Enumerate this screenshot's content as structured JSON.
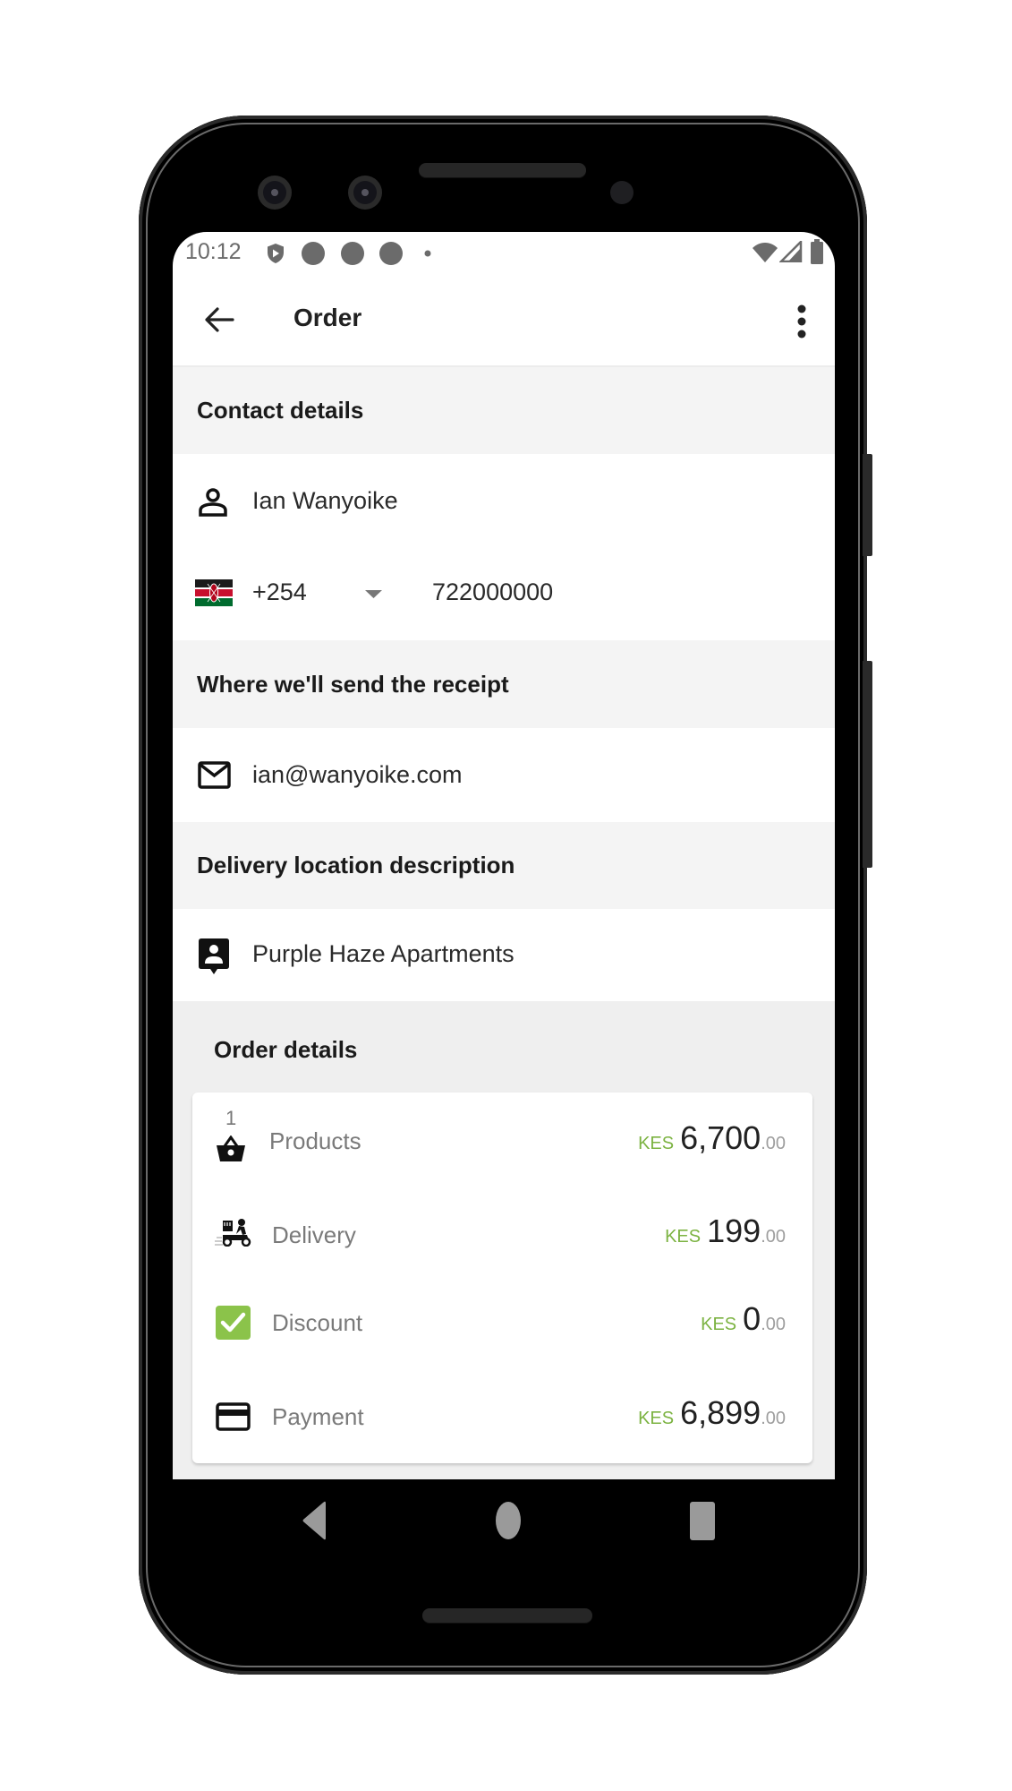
{
  "status_bar": {
    "time": "10:12",
    "icons": [
      "shield-play-icon",
      "notification-dot-icon",
      "notification-dot-icon",
      "notification-dot-icon",
      "small-dot-icon",
      "wifi-icon",
      "signal-icon",
      "battery-icon"
    ]
  },
  "app_bar": {
    "title": "Order",
    "back_icon": "arrow-back-icon",
    "menu_icon": "more-vert-icon"
  },
  "contact_details": {
    "header": "Contact details",
    "name": "Ian Wanyoike",
    "country_flag": "kenya-flag-icon",
    "country_code": "+254",
    "phone": "722000000"
  },
  "receipt": {
    "header": "Where we'll send the receipt",
    "email": "ian@wanyoike.com"
  },
  "delivery_location": {
    "header": "Delivery location description",
    "description": "Purple Haze Apartments"
  },
  "order_details": {
    "header": "Order details",
    "lines": [
      {
        "label": "Products",
        "icon": "basket-icon",
        "count": "1",
        "currency": "KES",
        "amount": "6,700",
        "decimals": ".00"
      },
      {
        "label": "Delivery",
        "icon": "delivery-scooter-icon",
        "currency": "KES",
        "amount": "199",
        "decimals": ".00"
      },
      {
        "label": "Discount",
        "icon": "checkbox-checked-icon",
        "currency": "KES",
        "amount": "0",
        "decimals": ".00"
      },
      {
        "label": "Payment",
        "icon": "credit-card-icon",
        "currency": "KES",
        "amount": "6,899",
        "decimals": ".00"
      }
    ]
  },
  "colors": {
    "accent_green": "#7cb342",
    "checkbox_green": "#8bc34a",
    "section_header_bg": "#f4f4f4"
  },
  "nav_bar": {
    "buttons": [
      "nav-back-icon",
      "nav-home-icon",
      "nav-recents-icon"
    ]
  }
}
